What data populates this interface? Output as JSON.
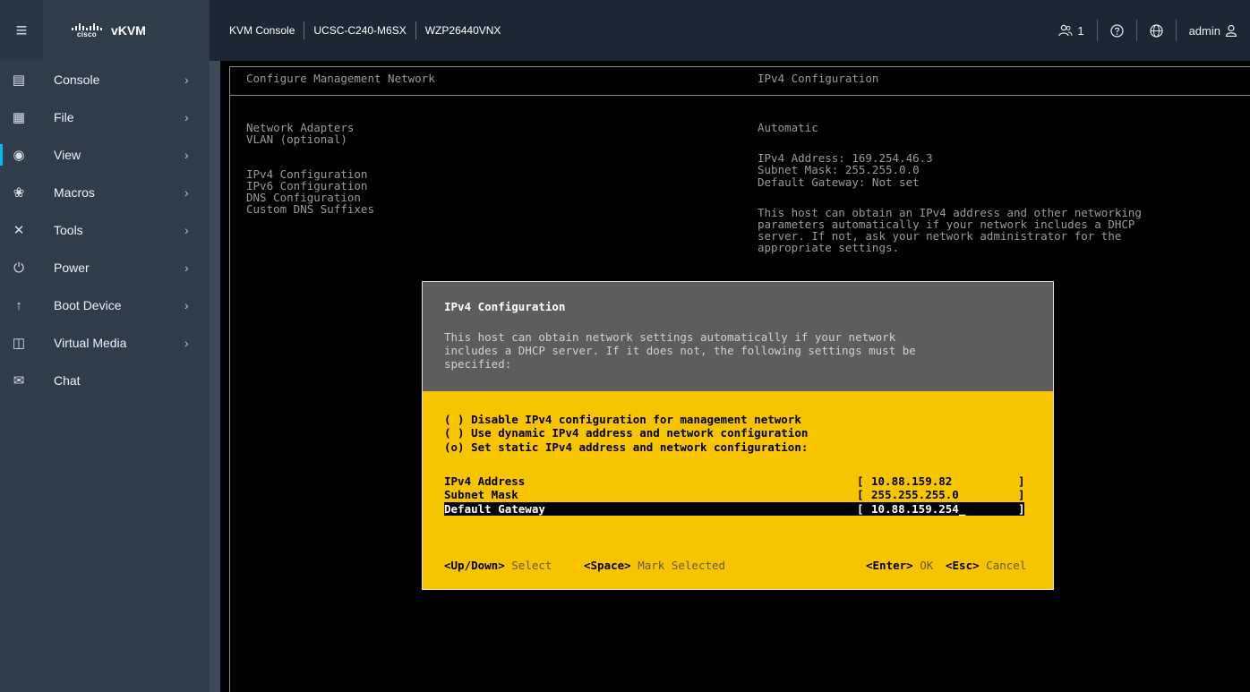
{
  "topbar": {
    "menu_icon": "hamburger-icon",
    "brand": {
      "logo_text": "cisco",
      "app_name": "vKVM"
    },
    "breadcrumbs": [
      "KVM Console",
      "UCSC-C240-M6SX",
      "WZP26440VNX"
    ],
    "sessions_count": "1",
    "user": "admin"
  },
  "sidebar": {
    "items": [
      {
        "label": "Console",
        "icon": "console-icon",
        "has_submenu": true
      },
      {
        "label": "File",
        "icon": "file-icon",
        "has_submenu": true
      },
      {
        "label": "View",
        "icon": "eye-icon",
        "has_submenu": true
      },
      {
        "label": "Macros",
        "icon": "macros-icon",
        "has_submenu": true
      },
      {
        "label": "Tools",
        "icon": "tools-icon",
        "has_submenu": true
      },
      {
        "label": "Power",
        "icon": "power-icon",
        "has_submenu": true
      },
      {
        "label": "Boot Device",
        "icon": "arrow-up-icon",
        "has_submenu": true
      },
      {
        "label": "Virtual Media",
        "icon": "virtual-media-icon",
        "has_submenu": true
      },
      {
        "label": "Chat",
        "icon": "chat-icon",
        "has_submenu": false
      }
    ]
  },
  "console": {
    "left_title": "Configure Management Network",
    "right_title": "IPv4 Configuration",
    "menu_items": [
      "Network Adapters",
      "VLAN (optional)",
      "IPv4 Configuration",
      "IPv6 Configuration",
      "DNS Configuration",
      "Custom DNS Suffixes"
    ],
    "right_mode": "Automatic",
    "right_ipv4": "IPv4 Address: 169.254.46.3",
    "right_mask": "Subnet Mask: 255.255.0.0",
    "right_gateway": "Default Gateway: Not set",
    "right_help": [
      "This host can obtain an IPv4 address and other networking",
      "parameters automatically if your network includes a DHCP",
      "server. If not, ask your network administrator for the",
      "appropriate settings."
    ]
  },
  "dialog": {
    "title": "IPv4 Configuration",
    "description": [
      "This host can obtain network settings automatically if your network",
      "includes a DHCP server. If it does not, the following settings must be",
      "specified:"
    ],
    "options": [
      "( ) Disable IPv4 configuration for management network",
      "( ) Use dynamic IPv4 address and network configuration",
      "(o) Set static IPv4 address and network configuration:"
    ],
    "fields": [
      {
        "label": "IPv4 Address",
        "value": "10.88.159.82"
      },
      {
        "label": "Subnet Mask",
        "value": "255.255.255.0"
      },
      {
        "label": "Default Gateway",
        "value": "10.88.159.254_"
      }
    ],
    "footer": {
      "updown_key": "<Up/Down>",
      "updown_hint": "Select",
      "space_key": "<Space>",
      "space_hint": "Mark Selected",
      "enter_key": "<Enter>",
      "enter_hint": "OK",
      "esc_key": "<Esc>",
      "esc_hint": "Cancel"
    }
  }
}
